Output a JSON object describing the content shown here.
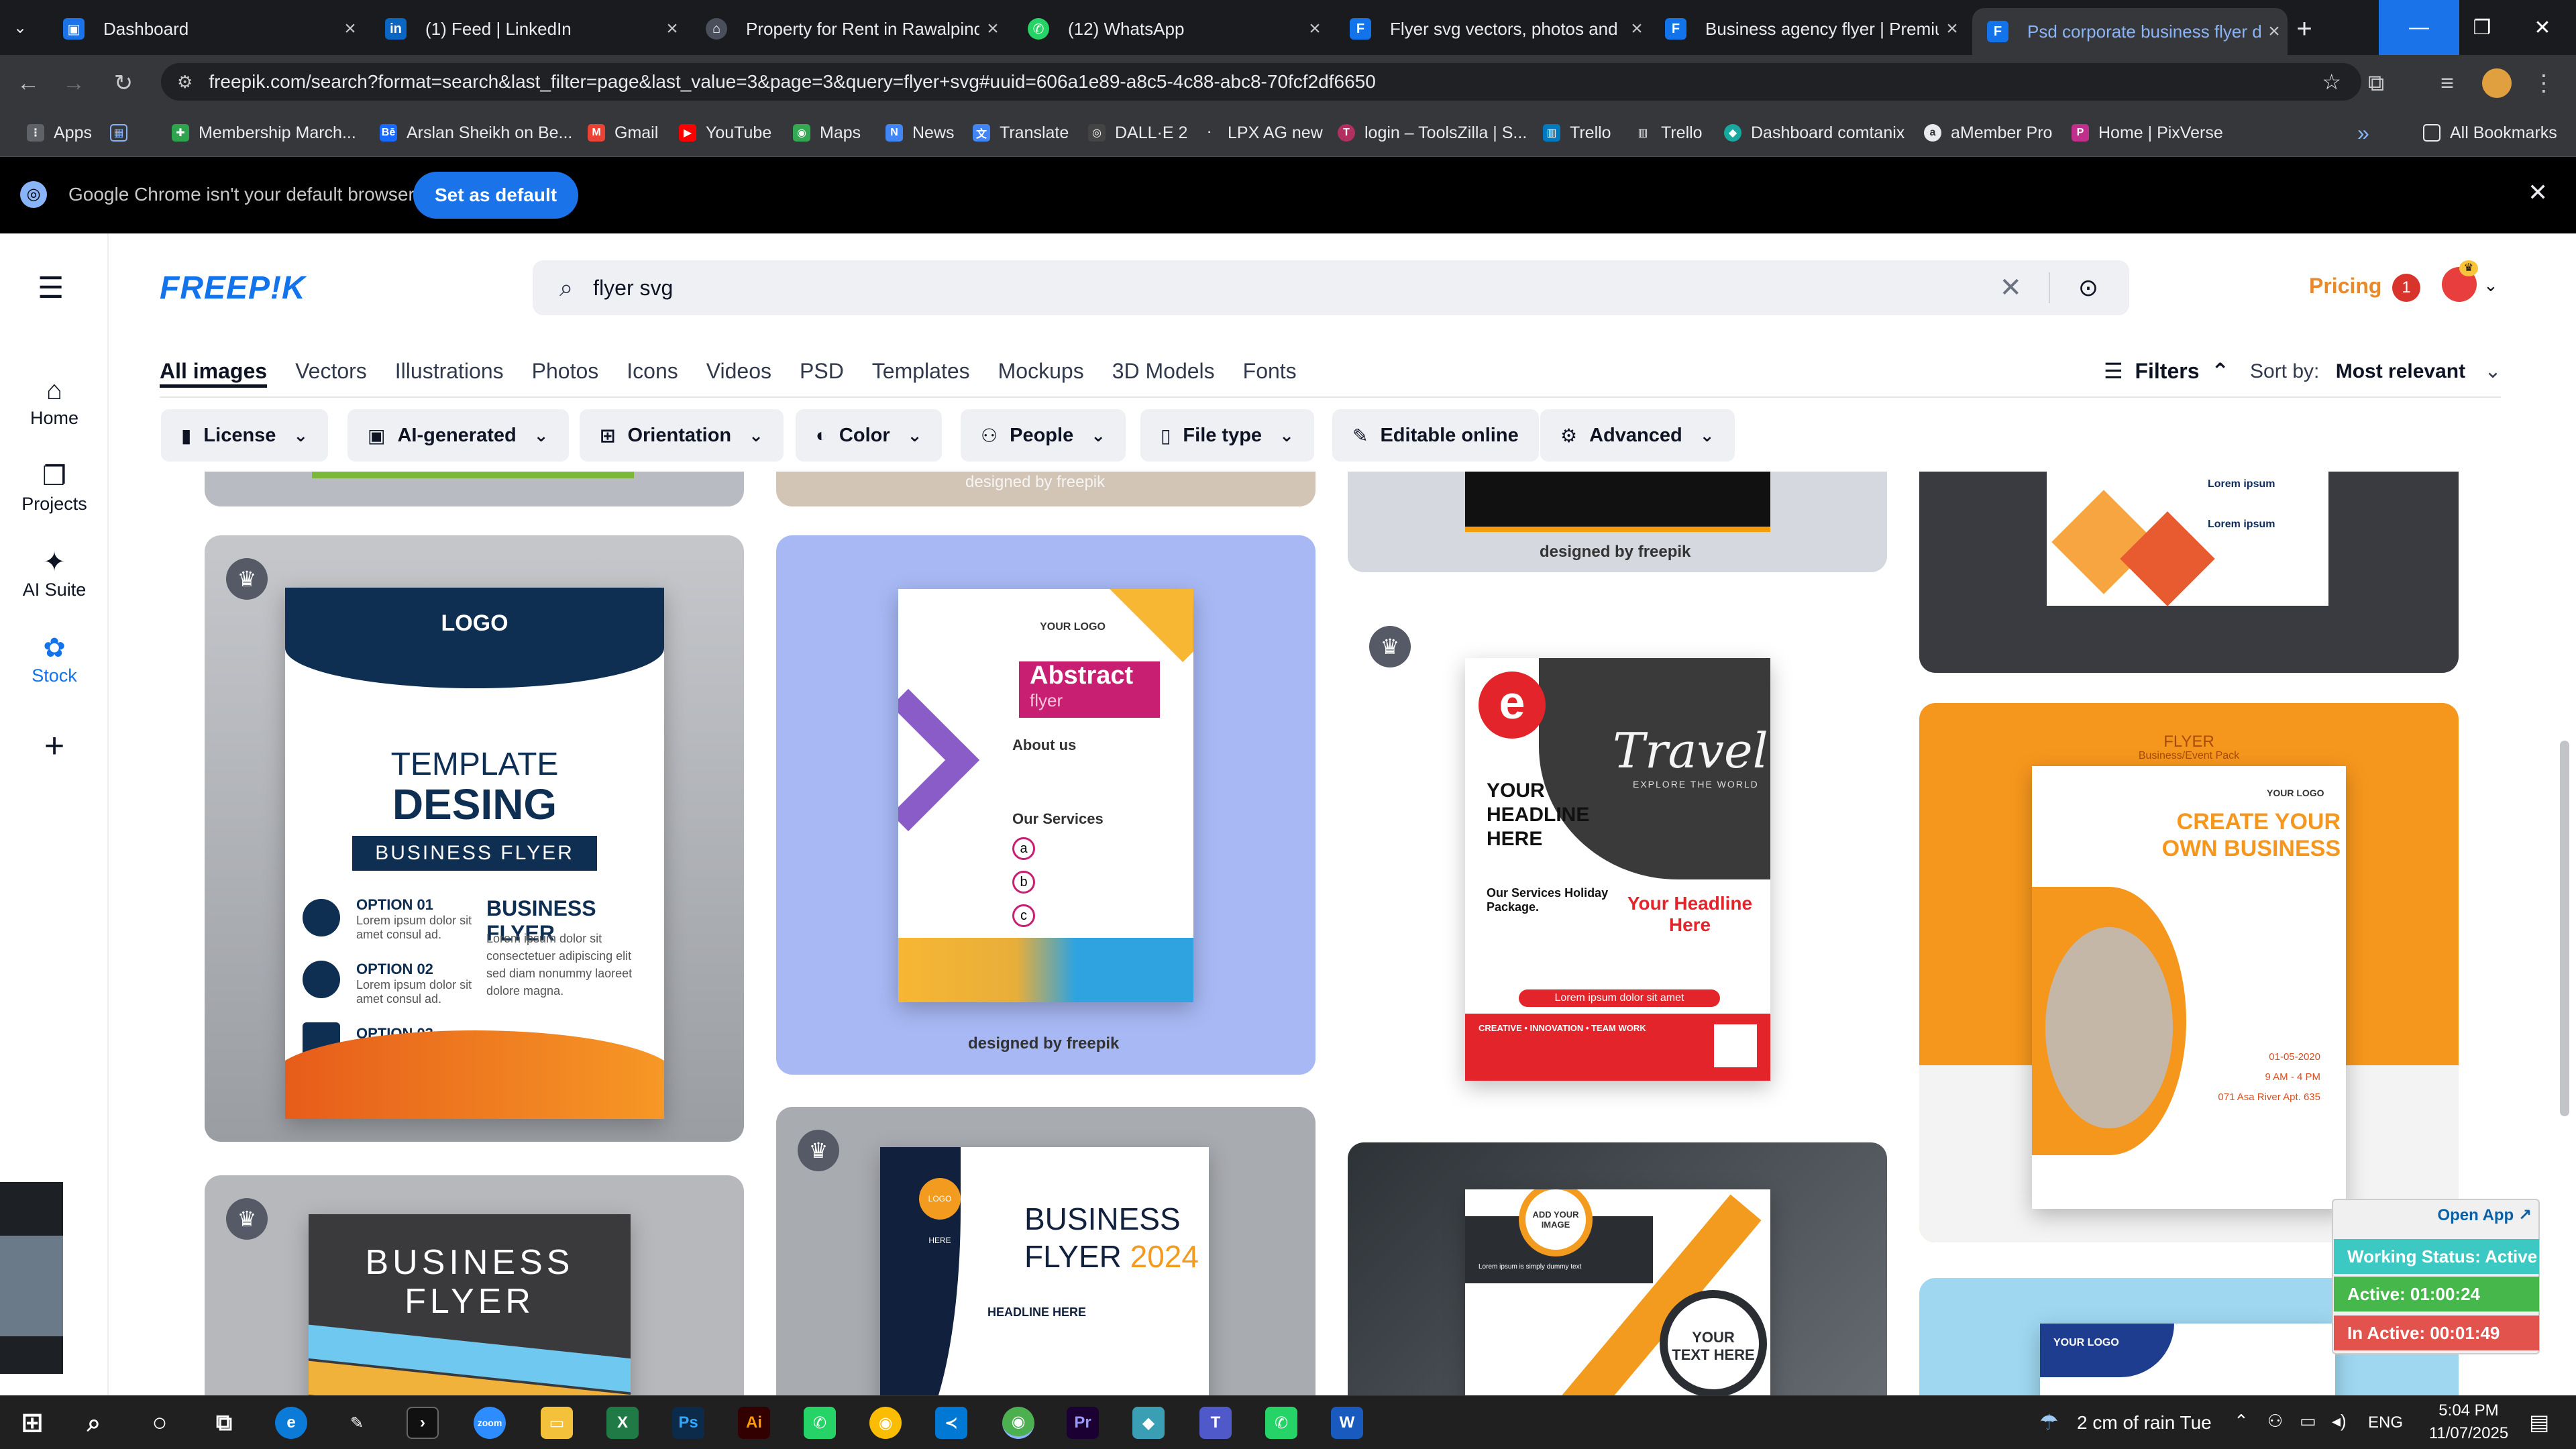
{
  "browser": {
    "tabs": [
      {
        "label": "Dashboard",
        "icon": "dashboard-tab-icon"
      },
      {
        "label": "(1) Feed | LinkedIn",
        "icon": "linkedin-icon"
      },
      {
        "label": "Property for Rent in Rawalpindi",
        "icon": "property-site-icon"
      },
      {
        "label": "(12) WhatsApp",
        "icon": "whatsapp-icon"
      },
      {
        "label": "Flyer svg vectors, photos and P",
        "icon": "freepik-icon"
      },
      {
        "label": "Business agency flyer | Premium",
        "icon": "freepik-icon"
      },
      {
        "label": "Psd corporate business flyer de",
        "icon": "freepik-icon"
      }
    ],
    "new_tab": "+",
    "url": "freepik.com/search?format=search&last_filter=page&last_value=3&page=3&query=flyer+svg#uuid=606a1e89-a8c5-4c88-abc8-70fcf2df6650",
    "bookmarks": [
      {
        "label": "Apps"
      },
      {
        "label": "Membership March..."
      },
      {
        "label": "Arslan Sheikh on Be..."
      },
      {
        "label": "Gmail"
      },
      {
        "label": "YouTube"
      },
      {
        "label": "Maps"
      },
      {
        "label": "News"
      },
      {
        "label": "Translate"
      },
      {
        "label": "DALL·E 2"
      },
      {
        "label": "LPX AG new"
      },
      {
        "label": "login – ToolsZilla | S..."
      },
      {
        "label": "Trello"
      },
      {
        "label": "Trello"
      },
      {
        "label": "Dashboard comtanix"
      },
      {
        "label": "aMember Pro"
      },
      {
        "label": "Home | PixVerse"
      }
    ],
    "more_bookmarks": "»",
    "all_bookmarks": "All Bookmarks",
    "default_banner": {
      "text": "Google Chrome isn't your default browser",
      "button": "Set as default"
    }
  },
  "freepik": {
    "logo": "FREEP!K",
    "sidebar": [
      {
        "label": "Home",
        "icon": "home-icon"
      },
      {
        "label": "Projects",
        "icon": "projects-icon"
      },
      {
        "label": "AI Suite",
        "icon": "ai-suite-icon"
      },
      {
        "label": "Stock",
        "icon": "stock-icon"
      }
    ],
    "search": {
      "value": "flyer svg"
    },
    "pricing": "Pricing",
    "notif_count": "1",
    "categories": [
      "All images",
      "Vectors",
      "Illustrations",
      "Photos",
      "Icons",
      "Videos",
      "PSD",
      "Templates",
      "Mockups",
      "3D Models",
      "Fonts"
    ],
    "filters_label": "Filters",
    "sort_label": "Sort by:",
    "sort_value": "Most relevant",
    "chips": [
      {
        "label": "License",
        "icon": "license-icon"
      },
      {
        "label": "AI-generated",
        "icon": "ai-generated-icon"
      },
      {
        "label": "Orientation",
        "icon": "orientation-icon"
      },
      {
        "label": "Color",
        "icon": "color-icon"
      },
      {
        "label": "People",
        "icon": "people-icon"
      },
      {
        "label": "File type",
        "icon": "file-type-icon"
      },
      {
        "label": "Editable online",
        "icon": "editable-online-icon"
      },
      {
        "label": "Advanced",
        "icon": "advanced-icon"
      }
    ],
    "watermark": "designed by freepik",
    "cards": {
      "template": {
        "logo": "LOGO",
        "title1": "TEMPLATE",
        "title2": "DESING",
        "subtitle": "BUSINESS FLYER",
        "options": [
          "OPTION 01",
          "OPTION 02",
          "OPTION 03"
        ],
        "option_text": "Lorem ipsum dolor sit amet consul ad.",
        "heading": "BUSINESS FLYER",
        "body": "Lorem ipsum dolor sit consectetuer adipiscing elit sed diam nonummy laoreet dolore magna."
      },
      "abstract": {
        "logo": "YOUR LOGO",
        "title": "Abstract",
        "sub": "flyer",
        "about": "About us",
        "services": "Our Services",
        "letters": [
          "a",
          "b",
          "c"
        ]
      },
      "travel": {
        "script": "Travel",
        "explore": "EXPLORE THE WORLD",
        "headline": "YOUR HEADLINE HERE",
        "services": "Our Services Holiday Package.",
        "headline2": "Your Headline Here",
        "footer": "CREATIVE • INNOVATION • TEAM WORK",
        "cta": "Lorem ipsum dolor sit amet"
      },
      "orange": {
        "flyer": "FLYER",
        "pack": "Business/Event Pack",
        "logo": "YOUR LOGO",
        "title1": "CREATE YOUR",
        "title2": "OWN BUSINESS",
        "date": "01-05-2020",
        "time": "9 AM - 4 PM",
        "address": "071 Asa River Apt. 635"
      },
      "topright": {
        "l1": "Lorem ipsum",
        "l2": "Lorem ipsum"
      },
      "biz2024": {
        "logo": "LOGO HERE",
        "title1": "BUSINESS",
        "title2": "FLYER",
        "year": "2024",
        "headline": "HEADLINE HERE"
      },
      "bizflyer": {
        "title1": "BUSINESS",
        "title2": "FLYER"
      },
      "addimg": {
        "add": "ADD YOUR IMAGE",
        "text1": "YOUR",
        "text2": "TEXT HERE",
        "lorem": "Lorem ipsum is simply dummy text"
      },
      "blue": {
        "logo": "YOUR LOGO"
      }
    },
    "open_app": "Open App ↗",
    "status": {
      "working": "Working Status: Active",
      "active": "Active: 01:00:24",
      "inactive": "In Active: 00:01:49"
    }
  },
  "taskbar": {
    "weather": "2 cm of rain Tue",
    "lang": "ENG",
    "time": "5:04 PM",
    "date": "11/07/2025",
    "apps": [
      "Start",
      "Search",
      "Cortana",
      "Task View",
      "Edge",
      "Pen",
      "Terminal",
      "Zoom",
      "File Explorer",
      "Excel",
      "Photoshop",
      "Illustrator",
      "WhatsApp",
      "Chrome",
      "VS Code",
      "Chrome Profile",
      "Premiere Pro",
      "App",
      "Teams",
      "WhatsApp",
      "Word"
    ]
  }
}
